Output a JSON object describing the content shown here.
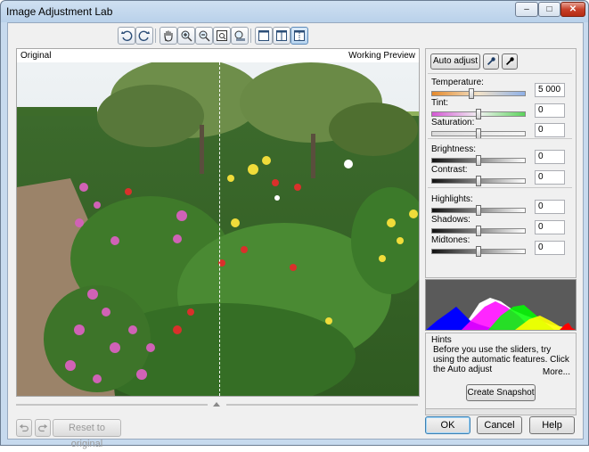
{
  "window": {
    "title": "Image Adjustment Lab"
  },
  "titlebar_buttons": {
    "minimize": "–",
    "maximize": "□",
    "close": "✕"
  },
  "toolbar": {
    "tools": [
      {
        "icon": "rotate-left-icon"
      },
      {
        "icon": "rotate-right-icon"
      },
      {
        "icon": "pan-hand-icon"
      },
      {
        "icon": "zoom-in-icon"
      },
      {
        "icon": "zoom-out-icon"
      },
      {
        "icon": "fit-to-window-icon"
      },
      {
        "icon": "zoom-actual-icon"
      },
      {
        "icon": "single-view-icon"
      },
      {
        "icon": "split-view-icon"
      },
      {
        "icon": "side-by-side-view-icon",
        "active": true
      }
    ]
  },
  "viewer": {
    "left_label": "Original",
    "right_label": "Working Preview"
  },
  "bottom": {
    "reset_label": "Reset to original",
    "ok_label": "OK",
    "cancel_label": "Cancel",
    "help_label": "Help"
  },
  "panel": {
    "auto_adjust_label": "Auto adjust",
    "sliders": [
      {
        "label": "Temperature:",
        "value": "5 000",
        "level": 0.42,
        "key": "temperature"
      },
      {
        "label": "Tint:",
        "value": "0",
        "level": 0.5,
        "key": "tint"
      },
      {
        "label": "Saturation:",
        "value": "0",
        "level": 0.5,
        "key": "saturation"
      },
      {
        "label": "Brightness:",
        "value": "0",
        "level": 0.5,
        "key": "brightness"
      },
      {
        "label": "Contrast:",
        "value": "0",
        "level": 0.5,
        "key": "contrast"
      },
      {
        "label": "Highlights:",
        "value": "0",
        "level": 0.5,
        "key": "highlights"
      },
      {
        "label": "Shadows:",
        "value": "0",
        "level": 0.5,
        "key": "shadows"
      },
      {
        "label": "Midtones:",
        "value": "0",
        "level": 0.5,
        "key": "midtones"
      }
    ]
  },
  "hints": {
    "title": "Hints",
    "text": "Before you use the sliders, try using the automatic features. Click the Auto adjust",
    "more_label": "More...",
    "snapshot_label": "Create Snapshot"
  }
}
